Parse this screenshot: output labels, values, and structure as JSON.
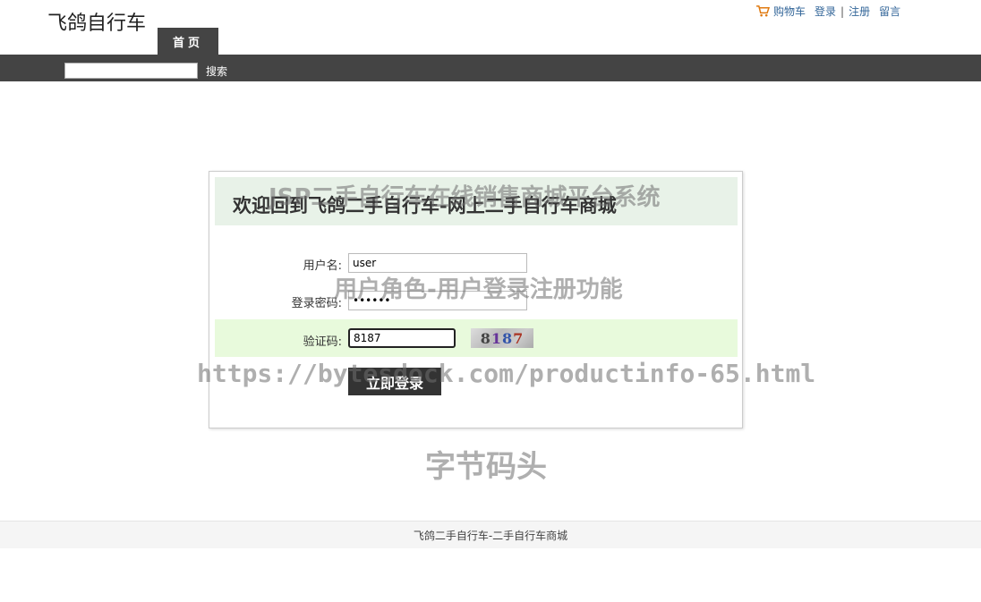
{
  "header": {
    "site_name": "飞鸽自行车",
    "top_links": {
      "cart": "购物车",
      "login": "登录",
      "separator": "|",
      "register": "注册",
      "message": "留言"
    }
  },
  "nav": {
    "home_tab": "首页",
    "search_button": "搜索",
    "search_value": ""
  },
  "login": {
    "title": "欢迎回到飞鸽二手自行车-网上二手自行车商城",
    "username_label": "用户名:",
    "username_value": "user",
    "password_label": "登录密码:",
    "password_value": "••••••",
    "captcha_label": "验证码:",
    "captcha_value": "8187",
    "captcha_image_text": [
      "8",
      "1",
      "8",
      "7"
    ],
    "submit_label": "立即登录"
  },
  "watermarks": {
    "line1": "JSP二手自行车在线销售商城平台系统",
    "line2": "用户角色-用户登录注册功能",
    "line3": "https://bytesdock.com/productinfo-65.html",
    "line4": "字节码头"
  },
  "footer": {
    "text": "飞鸽二手自行车-二手自行车商城"
  }
}
